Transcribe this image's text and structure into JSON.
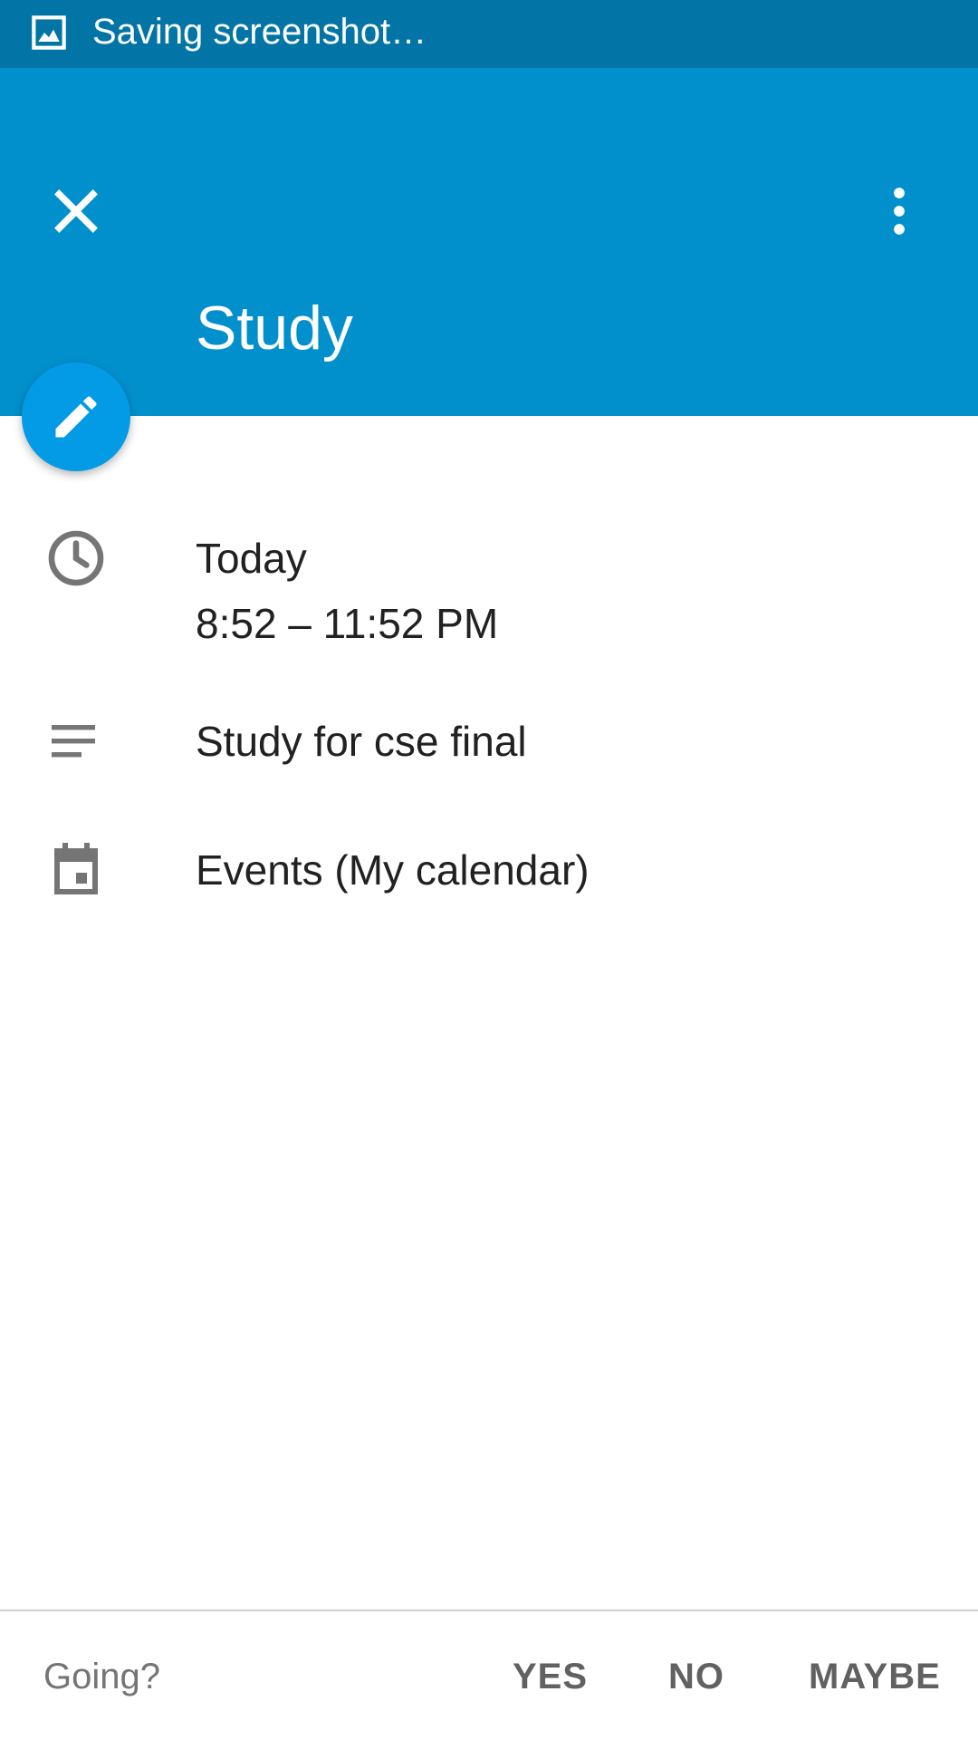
{
  "status_bar": {
    "text": "Saving screenshot…",
    "icon": "screenshot-image-icon"
  },
  "app_bar": {
    "close_icon": "close-icon",
    "more_icon": "more-vert-icon",
    "title": "Study",
    "color": "#0290cd"
  },
  "fab": {
    "icon": "pencil-icon",
    "color": "#039be5"
  },
  "details": {
    "date": "Today",
    "time": "8:52 – 11:52 PM",
    "description": "Study for cse final",
    "calendar": "Events (My calendar)"
  },
  "footer": {
    "prompt": "Going?",
    "yes": "YES",
    "no": "NO",
    "maybe": "MAYBE"
  }
}
